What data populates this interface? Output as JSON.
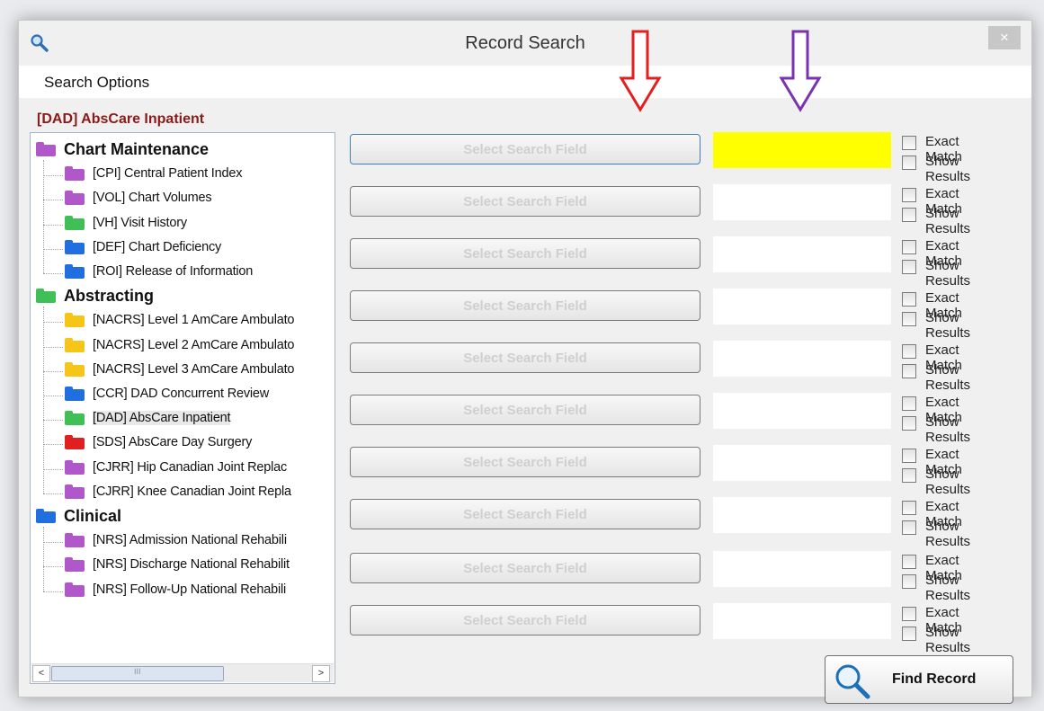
{
  "window": {
    "title": "Record Search",
    "close_symbol": "×",
    "app_icon": "magnifier-icon"
  },
  "menu": {
    "search_options": "Search Options"
  },
  "selected_database": "[DAD] AbsCare Inpatient",
  "tree": [
    {
      "kind": "cat",
      "label": "Chart Maintenance",
      "color": "#b057c9"
    },
    {
      "kind": "item",
      "label": "[CPI] Central Patient Index",
      "color": "#b057c9"
    },
    {
      "kind": "item",
      "label": "[VOL] Chart Volumes",
      "color": "#b057c9"
    },
    {
      "kind": "item",
      "label": "[VH] Visit History",
      "color": "#3fbf55"
    },
    {
      "kind": "item",
      "label": "[DEF] Chart Deficiency",
      "color": "#1f6fe0"
    },
    {
      "kind": "item",
      "label": "[ROI] Release of Information",
      "color": "#1f6fe0"
    },
    {
      "kind": "cat",
      "label": "Abstracting",
      "color": "#3fbf55"
    },
    {
      "kind": "item",
      "label": "[NACRS] Level 1 AmCare Ambulato",
      "color": "#f5c518"
    },
    {
      "kind": "item",
      "label": "[NACRS] Level 2 AmCare Ambulato",
      "color": "#f5c518"
    },
    {
      "kind": "item",
      "label": "[NACRS] Level 3 AmCare Ambulato",
      "color": "#f5c518"
    },
    {
      "kind": "item",
      "label": "[CCR] DAD Concurrent Review",
      "color": "#1f6fe0"
    },
    {
      "kind": "item",
      "label": "[DAD] AbsCare Inpatient",
      "color": "#3fbf55",
      "selected": true
    },
    {
      "kind": "item",
      "label": "[SDS] AbsCare Day Surgery",
      "color": "#e02020"
    },
    {
      "kind": "item",
      "label": "[CJRR] Hip Canadian Joint Replac",
      "color": "#b057c9"
    },
    {
      "kind": "item",
      "label": "[CJRR] Knee Canadian Joint Repla",
      "color": "#b057c9"
    },
    {
      "kind": "cat",
      "label": "Clinical",
      "color": "#1f6fe0"
    },
    {
      "kind": "item",
      "label": "[NRS] Admission National Rehabili",
      "color": "#b057c9"
    },
    {
      "kind": "item",
      "label": "[NRS] Discharge National Rehabilit",
      "color": "#b057c9"
    },
    {
      "kind": "item",
      "label": "[NRS] Follow-Up National Rehabili",
      "color": "#b057c9"
    }
  ],
  "scrollbar": {
    "left": "<",
    "right": ">",
    "grip": "III"
  },
  "search_rows": [
    {
      "field_label": "Select Search Field",
      "value": "",
      "highlighted": true
    },
    {
      "field_label": "Select Search Field",
      "value": ""
    },
    {
      "field_label": "Select Search Field",
      "value": ""
    },
    {
      "field_label": "Select Search Field",
      "value": ""
    },
    {
      "field_label": "Select Search Field",
      "value": ""
    },
    {
      "field_label": "Select Search Field",
      "value": ""
    },
    {
      "field_label": "Select Search Field",
      "value": ""
    },
    {
      "field_label": "Select Search Field",
      "value": ""
    },
    {
      "field_label": "Select Search Field",
      "value": ""
    },
    {
      "field_label": "Select Search Field",
      "value": ""
    }
  ],
  "exact_match_label": "Exact Match",
  "show_results_label": "Show Results",
  "find_button": {
    "label": "Find Record",
    "icon": "magnifier-icon"
  },
  "annotations": {
    "red_arrow_color": "#e21f1f",
    "purple_arrow_color": "#7a32b0"
  }
}
